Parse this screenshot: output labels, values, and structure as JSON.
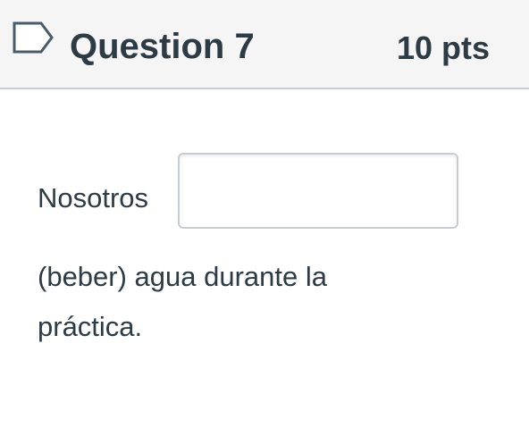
{
  "question": {
    "title": "Question 7",
    "points": "10 pts",
    "flag_icon": "flag-question-icon"
  },
  "prompt": {
    "text_before": "Nosotros",
    "text_after_line1": "(beber) agua durante la",
    "text_after_line2": "práctica."
  },
  "answer": {
    "value": "",
    "placeholder": ""
  },
  "colors": {
    "text": "#2d3b45",
    "header_bg": "#f5f5f5",
    "border": "#c7cdd1",
    "flag_stroke": "#4a5b6c"
  }
}
